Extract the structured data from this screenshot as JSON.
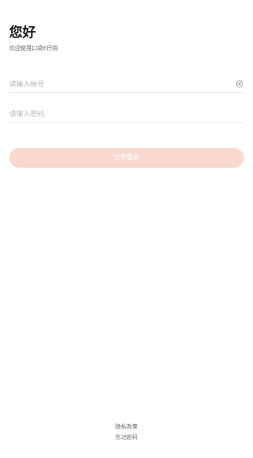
{
  "header": {
    "title": "您好",
    "subtitle": "欢迎使用口袋E行销"
  },
  "form": {
    "account": {
      "value": "",
      "placeholder": "请输入帐号",
      "clear_icon": "clear-circle-x-icon"
    },
    "password": {
      "value": "",
      "placeholder": "请输入密码"
    },
    "login_button_label": "立即登录"
  },
  "footer": {
    "privacy_label": "隐私政策",
    "forgot_label": "忘记密码"
  },
  "colors": {
    "login_button_bg": "#f9d9cf",
    "divider": "#e6e6e6",
    "placeholder": "#b5b5b5"
  }
}
